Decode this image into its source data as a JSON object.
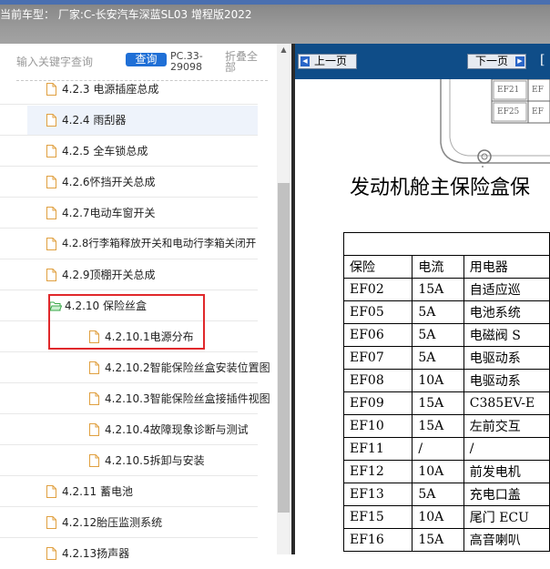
{
  "window": {
    "title": "当前车型：  厂家:C-长安汽车深蓝SL03 增程版2022"
  },
  "sidebar": {
    "search_placeholder": "输入关键字查询",
    "query_label": "查询",
    "pc_code": "PC.33-29098",
    "collapse_all_label": "折叠全部",
    "items": [
      {
        "label": "4.2.3 电源插座总成"
      },
      {
        "label": "4.2.4 雨刮器"
      },
      {
        "label": "4.2.5 全车锁总成"
      },
      {
        "label": "4.2.6怀挡开关总成"
      },
      {
        "label": "4.2.7电动车窗开关"
      },
      {
        "label": "4.2.8行李箱释放开关和电动行李箱关闭开"
      },
      {
        "label": "4.2.9顶棚开关总成"
      },
      {
        "label": "4.2.10 保险丝盒"
      },
      {
        "label": "4.2.10.1电源分布"
      },
      {
        "label": "4.2.10.2智能保险丝盒安装位置图"
      },
      {
        "label": "4.2.10.3智能保险丝盒接插件视图"
      },
      {
        "label": "4.2.10.4故障现象诊断与测试"
      },
      {
        "label": "4.2.10.5拆卸与安装"
      },
      {
        "label": "4.2.11 蓄电池"
      },
      {
        "label": "4.2.12胎压监测系统"
      },
      {
        "label": "4.2.13扬声器"
      }
    ]
  },
  "viewer": {
    "prev_label": "上一页",
    "next_label": "下一页",
    "nav_extra": "[",
    "diagram_labels": [
      "EF21",
      "EF25"
    ],
    "doc_title": "发动机舱主保险盒保",
    "table": {
      "headers": [
        "保险",
        "电流",
        "用电器"
      ],
      "rows": [
        [
          "EF02",
          "15A",
          "自适应巡"
        ],
        [
          "EF05",
          "5A",
          "电池系统"
        ],
        [
          "EF06",
          "5A",
          "电磁阀 S"
        ],
        [
          "EF07",
          "5A",
          "电驱动系"
        ],
        [
          "EF08",
          "10A",
          "电驱动系"
        ],
        [
          "EF09",
          "15A",
          "C385EV-E"
        ],
        [
          "EF10",
          "15A",
          "左前交互"
        ],
        [
          "EF11",
          "/",
          "/"
        ],
        [
          "EF12",
          "10A",
          "前发电机"
        ],
        [
          "EF13",
          "5A",
          "充电口盖"
        ],
        [
          "EF15",
          "10A",
          "尾门 ECU"
        ],
        [
          "EF16",
          "15A",
          "高音喇叭"
        ]
      ]
    }
  },
  "colors": {
    "nav_bar": "#0f4d88",
    "query_button": "#1f6fd6",
    "highlight_box": "#e0282b",
    "selected_row": "#eef3fb"
  }
}
